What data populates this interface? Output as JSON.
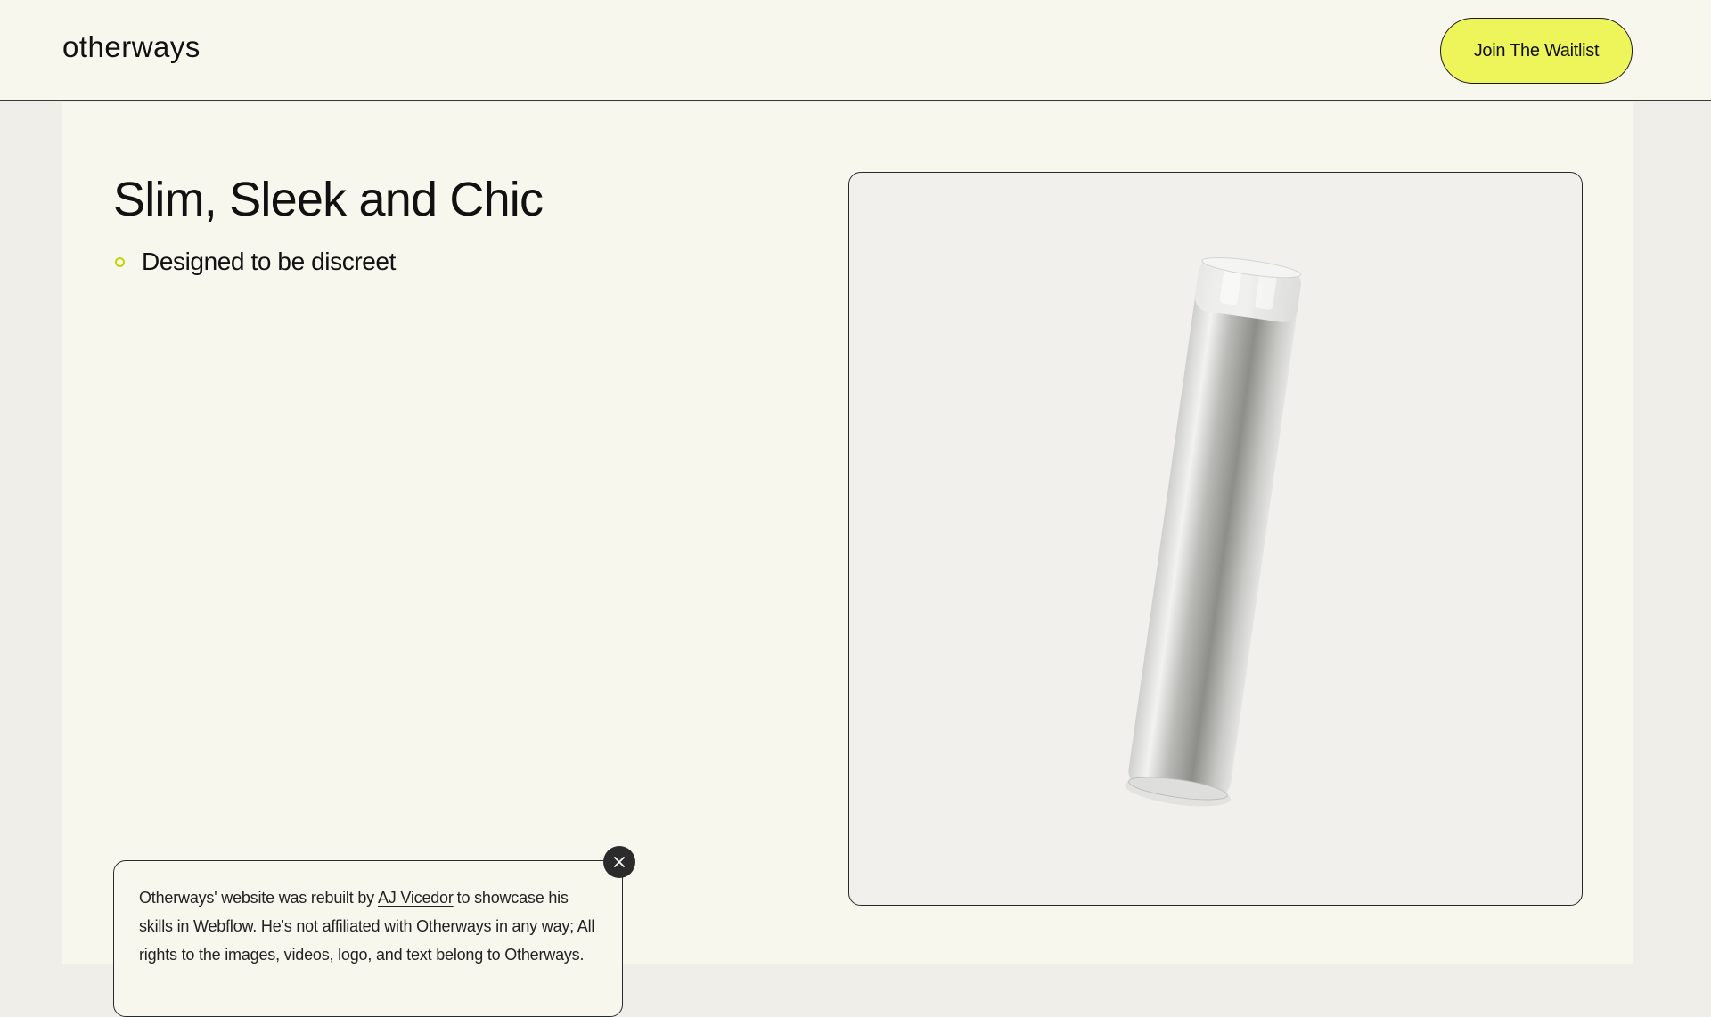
{
  "header": {
    "logo_text": "otherways",
    "cta_label": "Join The Waitlist"
  },
  "hero": {
    "heading": "Slim, Sleek and Chic",
    "bullets": [
      "Designed to be discreet"
    ]
  },
  "product": {
    "image_alt": "silver device"
  },
  "notice": {
    "text_before_link": "Otherways' website was rebuilt by",
    "link_label": "AJ Vicedor",
    "text_after_link": "to showcase his skills in Webflow. He's not affiliated with Otherways in any way; All rights to the images, videos, logo, and text belong to Otherways."
  },
  "colors": {
    "accent": "#eef55a",
    "bullet": "#c2d400",
    "background": "#f8f7ee",
    "side_gutter": "#efeee9",
    "product_background": "#f1f0ed"
  },
  "icons": {
    "close": "close-icon",
    "bullet": "bullet-dot-icon"
  }
}
